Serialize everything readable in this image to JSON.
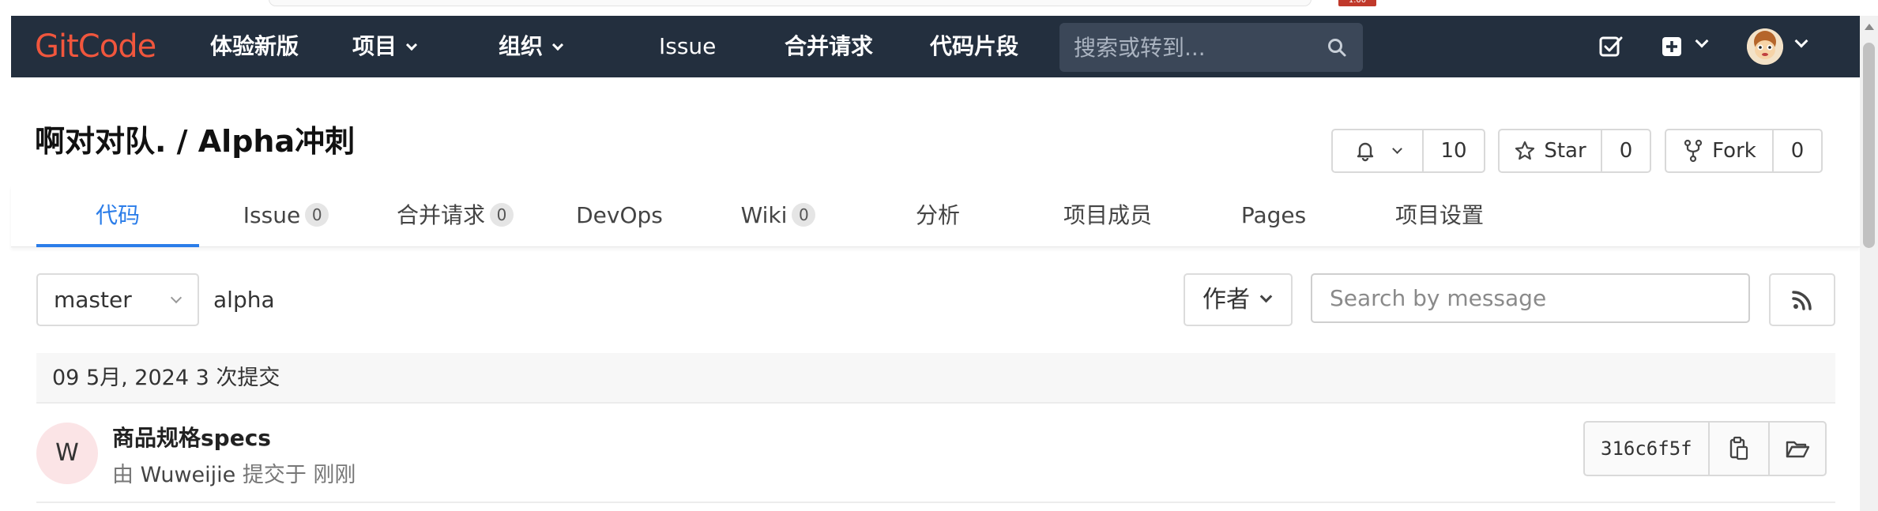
{
  "browser": {
    "badge": "1.00"
  },
  "nav": {
    "logo": "GitCode",
    "items": [
      "体验新版",
      "项目",
      "组织",
      "Issue",
      "合并请求",
      "代码片段"
    ],
    "search_placeholder": "搜索或转到...",
    "icons": [
      "search-icon",
      "todo-icon",
      "plus-square-icon",
      "avatar"
    ]
  },
  "project": {
    "breadcrumb": "啊对对队. / Alpha冲刺",
    "notify_count": "10",
    "star_label": "Star",
    "star_count": "0",
    "fork_label": "Fork",
    "fork_count": "0"
  },
  "tabs": [
    {
      "label": "代码",
      "badge": null
    },
    {
      "label": "Issue",
      "badge": "0"
    },
    {
      "label": "合并请求",
      "badge": "0"
    },
    {
      "label": "DevOps",
      "badge": null
    },
    {
      "label": "Wiki",
      "badge": "0"
    },
    {
      "label": "分析",
      "badge": null
    },
    {
      "label": "项目成员",
      "badge": null
    },
    {
      "label": "Pages",
      "badge": null
    },
    {
      "label": "项目设置",
      "badge": null
    }
  ],
  "filters": {
    "branch": "master",
    "path": "alpha",
    "author_label": "作者",
    "search_placeholder": "Search by message"
  },
  "commits": {
    "day_header": "09 5月, 2024 3 次提交",
    "items": [
      {
        "avatar_letter": "W",
        "title": "商品规格specs",
        "meta_prefix": "由",
        "author": "Wuweijie",
        "meta_suffix": "提交于 刚刚",
        "sha": "316c6f5f"
      }
    ]
  },
  "colors": {
    "nav_bg": "#232f3e",
    "logo": "#f0563d",
    "accent": "#2b7de9"
  }
}
